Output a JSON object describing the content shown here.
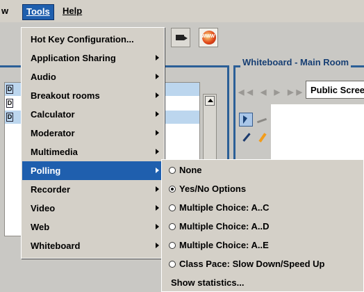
{
  "menubar": {
    "partial_prev": "w",
    "tools": "Tools",
    "help": "Help"
  },
  "toolbar": {
    "www_label": "WWW"
  },
  "left_panel": {
    "row_marks": [
      "D",
      "D",
      "D"
    ]
  },
  "whiteboard": {
    "title": "Whiteboard - Main Room",
    "nav_arrows": "◀◀ ◀ ▶ ▶▶",
    "page_select": "Public Screen"
  },
  "tools_menu": {
    "items": [
      {
        "label": "Hot Key Configuration...",
        "submenu": false
      },
      {
        "label": "Application Sharing",
        "submenu": true
      },
      {
        "label": "Audio",
        "submenu": true
      },
      {
        "label": "Breakout rooms",
        "submenu": true
      },
      {
        "label": "Calculator",
        "submenu": true
      },
      {
        "label": "Moderator",
        "submenu": true
      },
      {
        "label": "Multimedia",
        "submenu": true
      },
      {
        "label": "Polling",
        "submenu": true,
        "selected": true
      },
      {
        "label": "Recorder",
        "submenu": true
      },
      {
        "label": "Video",
        "submenu": true
      },
      {
        "label": "Web",
        "submenu": true
      },
      {
        "label": "Whiteboard",
        "submenu": true
      }
    ]
  },
  "polling_submenu": {
    "items": [
      {
        "label": "None",
        "radio": true,
        "checked": false
      },
      {
        "label": "Yes/No Options",
        "radio": true,
        "checked": true
      },
      {
        "label": "Multiple Choice: A..C",
        "radio": true,
        "checked": false
      },
      {
        "label": "Multiple Choice: A..D",
        "radio": true,
        "checked": false
      },
      {
        "label": "Multiple Choice: A..E",
        "radio": true,
        "checked": false
      },
      {
        "label": "Class Pace: Slow Down/Speed Up",
        "radio": true,
        "checked": false
      },
      {
        "label": "Show statistics...",
        "radio": false
      }
    ]
  },
  "colors": {
    "selection": "#1f5fae",
    "frame": "#2b5f97",
    "menu_bg": "#d4d0c8"
  }
}
